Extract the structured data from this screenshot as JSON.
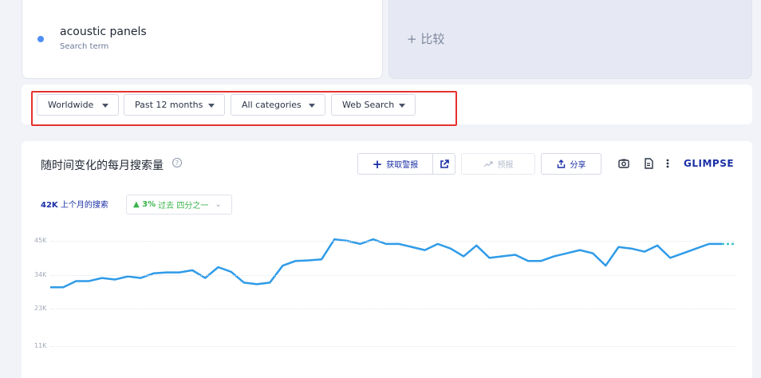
{
  "term": {
    "name": "acoustic panels",
    "subtitle": "Search term",
    "dot_color": "#4f8ef7"
  },
  "compare": {
    "label": "+ 比较"
  },
  "filters": [
    {
      "label": "Worldwide"
    },
    {
      "label": "Past 12 months"
    },
    {
      "label": "All categories"
    },
    {
      "label": "Web Search"
    }
  ],
  "chart_header": {
    "title": "随时间变化的每月搜索量",
    "help": "?",
    "alert_label": "获取警报",
    "forecast_label": "预报",
    "share_label": "分享",
    "brand": "GLIMPSE"
  },
  "stats": {
    "volume": "42K",
    "volume_label": "上个月的搜索",
    "growth": "▲ 3%",
    "growth_label": "过去 四分之一"
  },
  "colors": {
    "accent": "#1a2fa6",
    "line": "#2f9be8",
    "highlight": "#e5322d",
    "growth": "#37b34a"
  },
  "chart_data": {
    "type": "line",
    "y_ticks": [
      "45K",
      "34K",
      "23K",
      "11K"
    ],
    "y_tick_values": [
      45000,
      34000,
      23000,
      11000
    ],
    "ylim": [
      0,
      49000
    ],
    "grid": true,
    "series": [
      {
        "values": [
          30000,
          30000,
          32000,
          32000,
          33000,
          32500,
          33500,
          33000,
          34500,
          34800,
          34800,
          35500,
          33000,
          36500,
          35000,
          31500,
          31000,
          31500,
          37000,
          38500,
          38700,
          39000,
          45500,
          45000,
          44000,
          45500,
          44000,
          44000,
          43000,
          42000,
          44000,
          42500,
          40000,
          43500,
          39500,
          40000,
          40500,
          38500,
          38500,
          40000,
          41000,
          42000,
          41000,
          37000,
          43000,
          42500,
          41500,
          43500,
          39500,
          41000,
          42500,
          44000,
          44000
        ]
      }
    ]
  }
}
